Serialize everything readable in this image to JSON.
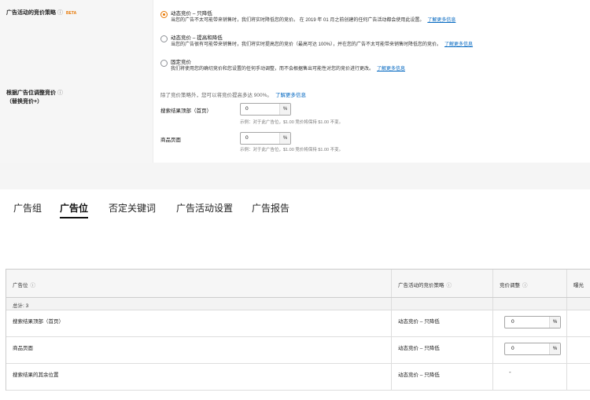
{
  "settings": {
    "strategy_label": "广告活动的竞价策略",
    "beta": "BETA",
    "info_icon": "info-icon",
    "options": [
      {
        "title": "动态竞价 – 只降低",
        "desc": "当您的广告不太可能带来销售时，我们将实时降低您的竞价。 在 2019 年 01 月之前创建的任何广告活动都会使用此设置。",
        "link": "了解更多信息",
        "selected": true
      },
      {
        "title": "动态竞价 – 提高和降低",
        "desc": "当您的广告很有可能带来销售时，我们将实时提高您的竞价（最高可达 100%），并在您的广告不太可能带来销售时降低您的竞价。",
        "link": "了解更多信息",
        "selected": false
      },
      {
        "title": "固定竞价",
        "desc": "我们将使用您的确切竞价和您设置的任何手动调整，而不会根据售出可能性对您的竞价进行更改。",
        "link": "了解更多信息",
        "selected": false
      }
    ],
    "placement_label": "根据广告位调整竞价",
    "placement_sub": "（替换竞价+）",
    "note": "除了竞价策略外，您可以将竞价提高多达 900%。",
    "note_link": "了解更多信息",
    "adjustments": [
      {
        "label": "搜索结果顶部（首页）",
        "value": "0",
        "suffix": "%",
        "hint": "示例：对于此广告位，$1.00 竞价将保持 $1.00 不变。"
      },
      {
        "label": "商品页面",
        "value": "0",
        "suffix": "%",
        "hint": "示例：对于此广告位，$1.00 竞价将保持 $1.00 不变。"
      }
    ]
  },
  "tabs": [
    {
      "label": "广告组",
      "active": false
    },
    {
      "label": "广告位",
      "active": true
    },
    {
      "label": "否定关键词",
      "active": false
    },
    {
      "label": "广告活动设置",
      "active": false
    },
    {
      "label": "广告报告",
      "active": false
    }
  ],
  "table": {
    "headers": [
      "广告位",
      "广告活动的竞价策略",
      "竞价调整",
      "曝光"
    ],
    "total": "总计: 3",
    "rows": [
      {
        "placement": "搜索结果顶部（首页）",
        "strategy": "动态竞价 – 只降低",
        "adjust": "0",
        "suffix": "%"
      },
      {
        "placement": "商品页面",
        "strategy": "动态竞价 – 只降低",
        "adjust": "0",
        "suffix": "%"
      },
      {
        "placement": "搜索结果的其余位置",
        "strategy": "动态竞价 – 只降低",
        "adjust": "-"
      }
    ]
  },
  "colors": {
    "accent": "#e77600",
    "link": "#0066c0"
  }
}
